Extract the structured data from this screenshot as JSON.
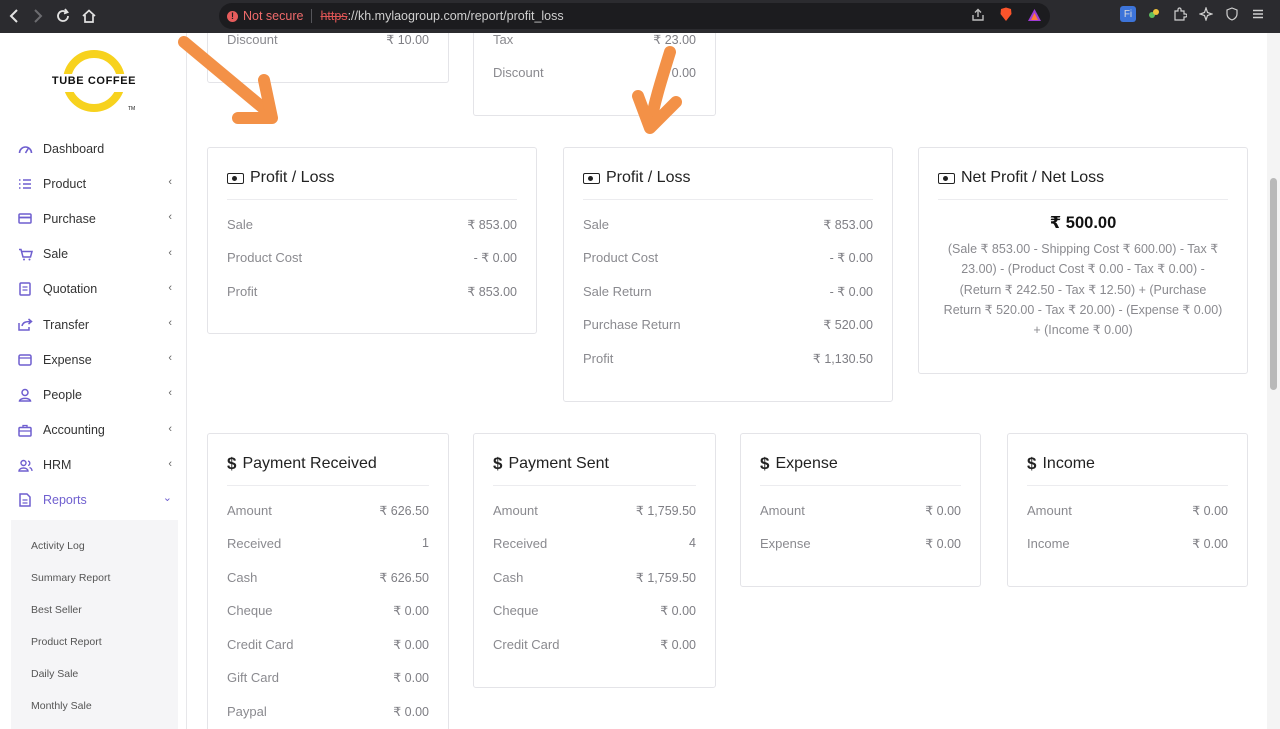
{
  "browser": {
    "security_label": "Not secure",
    "url_scheme": "https",
    "url_rest": "://kh.mylaogroup.com/report/profit_loss"
  },
  "logo": {
    "text": "TUBE COFFEE",
    "tm": "TM"
  },
  "sidebar": {
    "items": [
      {
        "label": "Dashboard"
      },
      {
        "label": "Product"
      },
      {
        "label": "Purchase"
      },
      {
        "label": "Sale"
      },
      {
        "label": "Quotation"
      },
      {
        "label": "Transfer"
      },
      {
        "label": "Expense"
      },
      {
        "label": "People"
      },
      {
        "label": "Accounting"
      },
      {
        "label": "HRM"
      },
      {
        "label": "Reports"
      }
    ],
    "sub_items": [
      {
        "label": "Activity Log"
      },
      {
        "label": "Summary Report"
      },
      {
        "label": "Best Seller"
      },
      {
        "label": "Product Report"
      },
      {
        "label": "Daily Sale"
      },
      {
        "label": "Monthly Sale"
      }
    ]
  },
  "top_cards": [
    {
      "rows": [
        {
          "label": "Discount",
          "value": "₹ 10.00"
        }
      ]
    },
    {
      "rows": [
        {
          "label": "Tax",
          "value": "₹ 23.00"
        },
        {
          "label": "Discount",
          "value": "₹ 0.00"
        }
      ]
    }
  ],
  "profit_loss_1": {
    "title": "Profit / Loss",
    "rows": [
      {
        "label": "Sale",
        "value": "₹ 853.00"
      },
      {
        "label": "Product Cost",
        "value": "- ₹ 0.00"
      },
      {
        "label": "Profit",
        "value": "₹ 853.00"
      }
    ]
  },
  "profit_loss_2": {
    "title": "Profit / Loss",
    "rows": [
      {
        "label": "Sale",
        "value": "₹ 853.00"
      },
      {
        "label": "Product Cost",
        "value": "- ₹ 0.00"
      },
      {
        "label": "Sale Return",
        "value": "- ₹ 0.00"
      },
      {
        "label": "Purchase Return",
        "value": "₹ 520.00"
      },
      {
        "label": "Profit",
        "value": "₹ 1,130.50"
      }
    ]
  },
  "net_profit": {
    "title": "Net Profit / Net Loss",
    "value": "₹ 500.00",
    "formula": "(Sale ₹ 853.00 - Shipping Cost ₹ 600.00) - Tax ₹ 23.00) - (Product Cost ₹ 0.00 - Tax ₹ 0.00) - (Return ₹ 242.50 - Tax ₹ 12.50) + (Purchase Return ₹ 520.00 - Tax ₹ 20.00) - (Expense ₹ 0.00) + (Income ₹ 0.00)"
  },
  "payment_received": {
    "title": "Payment Received",
    "rows": [
      {
        "label": "Amount",
        "value": "₹ 626.50"
      },
      {
        "label": "Received",
        "value": "1"
      },
      {
        "label": "Cash",
        "value": "₹ 626.50"
      },
      {
        "label": "Cheque",
        "value": "₹ 0.00"
      },
      {
        "label": "Credit Card",
        "value": "₹ 0.00"
      },
      {
        "label": "Gift Card",
        "value": "₹ 0.00"
      },
      {
        "label": "Paypal",
        "value": "₹ 0.00"
      }
    ]
  },
  "payment_sent": {
    "title": "Payment Sent",
    "rows": [
      {
        "label": "Amount",
        "value": "₹ 1,759.50"
      },
      {
        "label": "Received",
        "value": "4"
      },
      {
        "label": "Cash",
        "value": "₹ 1,759.50"
      },
      {
        "label": "Cheque",
        "value": "₹ 0.00"
      },
      {
        "label": "Credit Card",
        "value": "₹ 0.00"
      }
    ]
  },
  "expense": {
    "title": "Expense",
    "rows": [
      {
        "label": "Amount",
        "value": "₹ 0.00"
      },
      {
        "label": "Expense",
        "value": "₹ 0.00"
      }
    ]
  },
  "income": {
    "title": "Income",
    "rows": [
      {
        "label": "Amount",
        "value": "₹ 0.00"
      },
      {
        "label": "Income",
        "value": "₹ 0.00"
      }
    ]
  },
  "colors": {
    "accent": "#6f5fcf",
    "arrow": "#f39147",
    "logo": "#f7d21e"
  }
}
